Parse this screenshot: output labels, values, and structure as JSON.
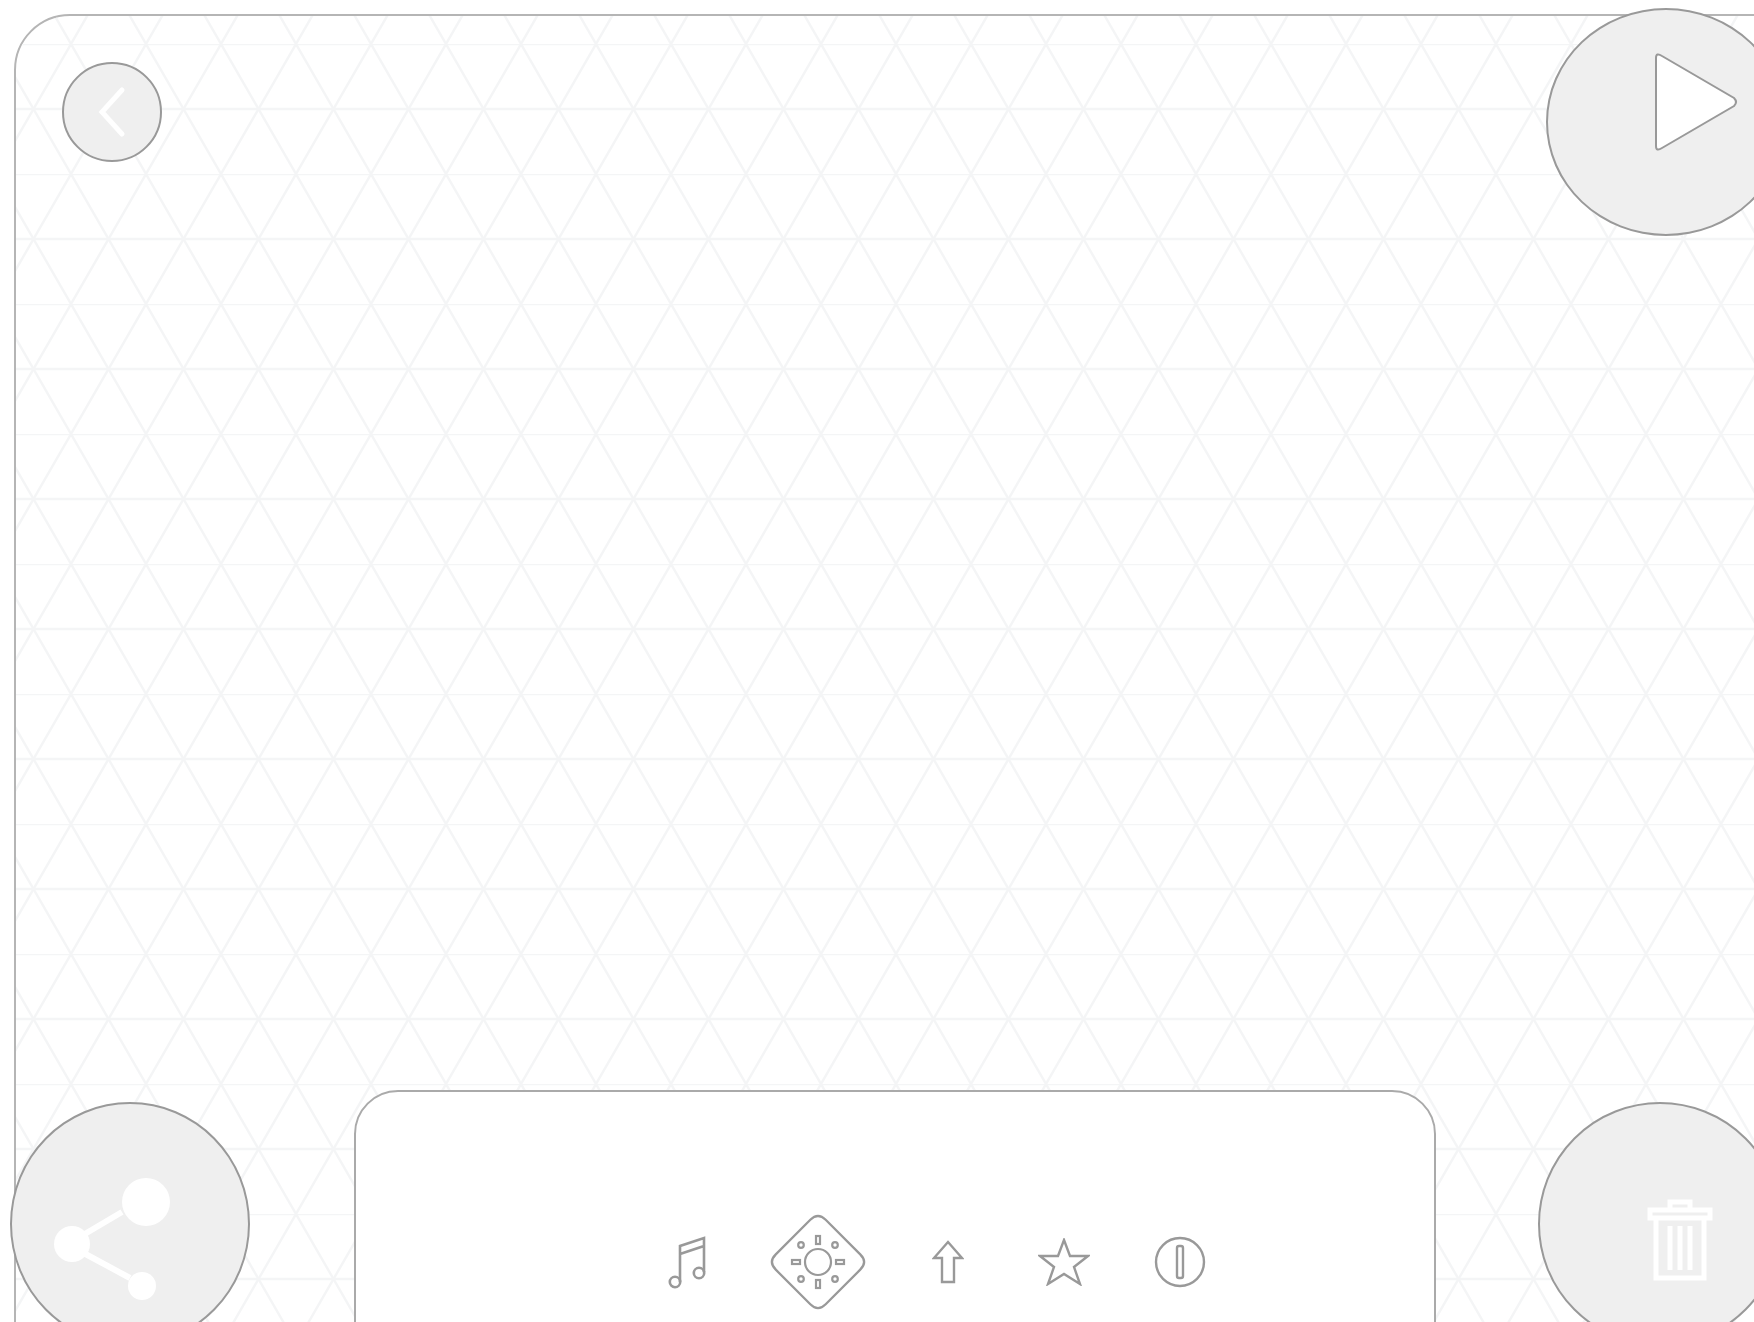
{
  "toolbar": {
    "items": [
      {
        "kind": "music",
        "selected": false
      },
      {
        "kind": "sun",
        "selected": true
      },
      {
        "kind": "arrow-up",
        "selected": false
      },
      {
        "kind": "star",
        "selected": false
      },
      {
        "kind": "alert",
        "selected": false
      }
    ]
  }
}
